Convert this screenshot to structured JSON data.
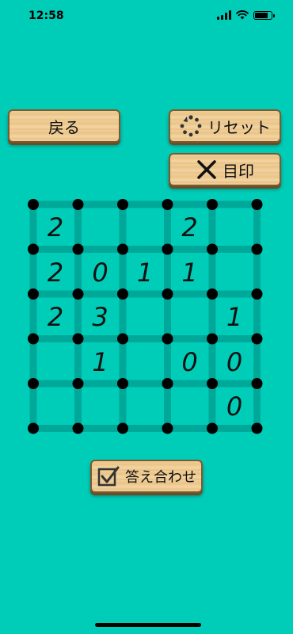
{
  "status": {
    "time": "12:58",
    "battery_level": 0.85
  },
  "buttons": {
    "back": "戻る",
    "reset": "リセット",
    "mark": "目印",
    "check": "答え合わせ"
  },
  "colors": {
    "background": "#00CDB8",
    "grid_line": "#00A89A",
    "dot": "#000000"
  },
  "puzzle": {
    "rows": 5,
    "cols": 5,
    "cells": [
      [
        "2",
        "",
        "",
        "2",
        ""
      ],
      [
        "2",
        "0",
        "1",
        "1",
        ""
      ],
      [
        "2",
        "3",
        "",
        "",
        "1"
      ],
      [
        "",
        "1",
        "",
        "0",
        "0"
      ],
      [
        "",
        "",
        "",
        "",
        "0"
      ]
    ]
  }
}
